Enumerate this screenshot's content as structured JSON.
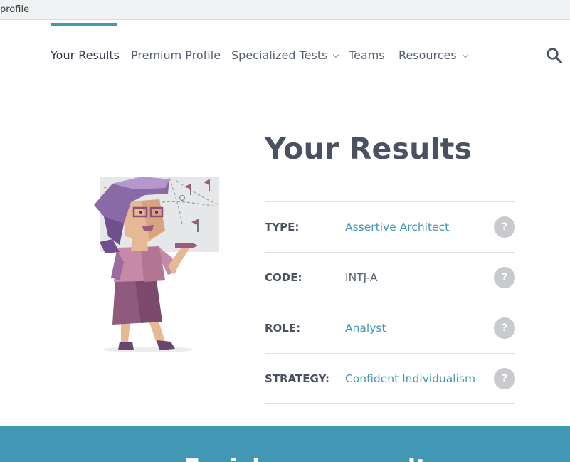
{
  "browser": {
    "url_fragment": "profile"
  },
  "nav": {
    "items": [
      {
        "label": "Your Results",
        "active": true,
        "dropdown": false
      },
      {
        "label": "Premium Profile",
        "active": false,
        "dropdown": false
      },
      {
        "label": "Specialized Tests",
        "active": false,
        "dropdown": true
      },
      {
        "label": "Teams",
        "active": false,
        "dropdown": false
      },
      {
        "label": "Resources",
        "active": false,
        "dropdown": true
      }
    ],
    "search_icon": "search-icon"
  },
  "hero": {
    "title": "Your Results",
    "illustration": "character-architect-illustration"
  },
  "results": [
    {
      "label": "TYPE:",
      "value": "Assertive Architect",
      "link": true
    },
    {
      "label": "CODE:",
      "value": "INTJ-A",
      "link": false
    },
    {
      "label": "ROLE:",
      "value": "Analyst",
      "link": true
    },
    {
      "label": "STRATEGY:",
      "value": "Confident Individualism",
      "link": true
    }
  ],
  "help_icon": "question-icon",
  "help_glyph": "?",
  "banner": {
    "partial_text": "Enrich your results"
  },
  "colors": {
    "accent": "#4298b4",
    "heading": "#4a5160",
    "text": "#576071",
    "help_bg": "#c8cacd"
  }
}
